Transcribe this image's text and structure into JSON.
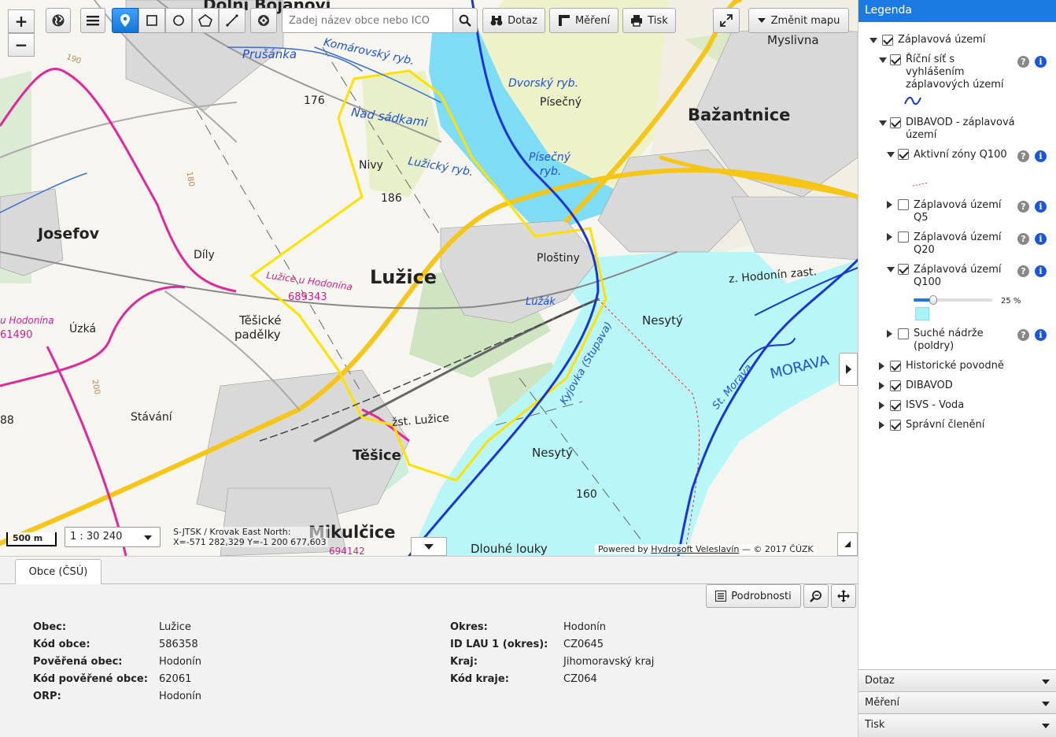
{
  "toolbar": {
    "search_placeholder": "Zadej název obce nebo IČO",
    "query_label": "Dotaz",
    "measure_label": "Měření",
    "print_label": "Tisk",
    "change_map_label": "Změnit mapu",
    "zoom_in": "+",
    "zoom_out": "−"
  },
  "map": {
    "scale_bar": "500 m",
    "scale_value": "1 : 30 240",
    "coords_line1": "S-JTSK / Krovak East North:",
    "coords_line2": "X=-571 282,329 Y=-1 200 677,603",
    "powered_prefix": "Powered by ",
    "powered_link": "Hydrosoft Veleslavín",
    "powered_suffix": " — © 2017 ČÚZK",
    "labels": {
      "dolni_bojanovice": "Dolní Bojanovi",
      "prusanka": "Prušánka",
      "komarovsky": "Komárovský ryb.",
      "dvorsky": "Dvorský ryb.",
      "pisecny": "Písečný",
      "pisecny_ryb1": "Písečný",
      "pisecny_ryb2": "ryb.",
      "bazantnice": "Bažantnice",
      "myslivna": "Myslivna",
      "nad_sadkami": "Nad sádkami",
      "luzicky": "Lužický ryb.",
      "nivy": "Nivy",
      "v186": "186",
      "v176": "176",
      "josefov": "Josefov",
      "dily": "Díly",
      "luzice": "Lužice",
      "luzice_u_hod": "Lužice u Hodonína",
      "code_689343": "689343",
      "plostiny": "Ploštiny",
      "luzak": "Lužák",
      "z_hodonin": "z. Hodonín zast.",
      "nesyty1": "Nesytý",
      "nesyty2": "Nesytý",
      "u_hodonina": "u Hodonína",
      "code_61490": "61490",
      "uzka": "Úzká",
      "tesicke1": "Těšické",
      "tesicke2": "padělky",
      "stavani": "Stávání",
      "v88": "88",
      "zst_luzice": "žst. Lužice",
      "tesice": "Těšice",
      "kyjovka": "Kyjovka (Stupava)",
      "st_morava": "St. Morava",
      "morava": "MORAVA",
      "v160": "160",
      "mikulcice": "Mikulčice",
      "dlouhe": "Dlouhé louky",
      "v180": "180",
      "v190": "190",
      "v200": "200",
      "code_694142": "694142"
    }
  },
  "legend": {
    "title": "Legenda",
    "items": [
      {
        "label": "Záplavová území",
        "checked": true
      },
      {
        "label": "Říční síť s vyhlášením záplavových území",
        "checked": true
      },
      {
        "label": "DIBAVOD - záplavová území",
        "checked": true
      },
      {
        "label": "Aktivní zóny Q100",
        "checked": true
      },
      {
        "label": "Záplavová území Q5",
        "checked": false
      },
      {
        "label": "Záplavová území Q20",
        "checked": false
      },
      {
        "label": "Záplavová území Q100",
        "checked": true
      },
      {
        "label": "Suché nádrže (poldry)",
        "checked": false
      },
      {
        "label": "Historické povodně",
        "checked": true
      },
      {
        "label": "DIBAVOD",
        "checked": true
      },
      {
        "label": "ISVS - Voda",
        "checked": true
      },
      {
        "label": "Správní členění",
        "checked": true
      }
    ],
    "opacity": {
      "value": 0.25,
      "label": "25 %"
    },
    "help_glyph": "?",
    "info_glyph": "i"
  },
  "side_tabs": {
    "query": "Dotaz",
    "measure": "Měření",
    "print": "Tisk"
  },
  "bottom": {
    "tab_label": "Obce (ČSÚ)",
    "details_label": "Podrobnosti",
    "left": [
      {
        "k": "Obec:",
        "v": "Lužice"
      },
      {
        "k": "Kód obce:",
        "v": "586358"
      },
      {
        "k": "Pověřená obec:",
        "v": "Hodonín"
      },
      {
        "k": "Kód pověřené obce:",
        "v": "62061"
      },
      {
        "k": "ORP:",
        "v": "Hodonín"
      }
    ],
    "right": [
      {
        "k": "Okres:",
        "v": "Hodonín"
      },
      {
        "k": "ID LAU 1 (okres):",
        "v": "CZ0645"
      },
      {
        "k": "Kraj:",
        "v": "Jihomoravský kraj"
      },
      {
        "k": "Kód kraje:",
        "v": "CZ064"
      }
    ]
  },
  "colors": {
    "accent": "#1a7ae2",
    "flood_zone": "#a9f3f6",
    "river": "#1a35d6",
    "admin_border": "#ffe100",
    "district_border": "#e0289a",
    "road": "#f5c518"
  }
}
